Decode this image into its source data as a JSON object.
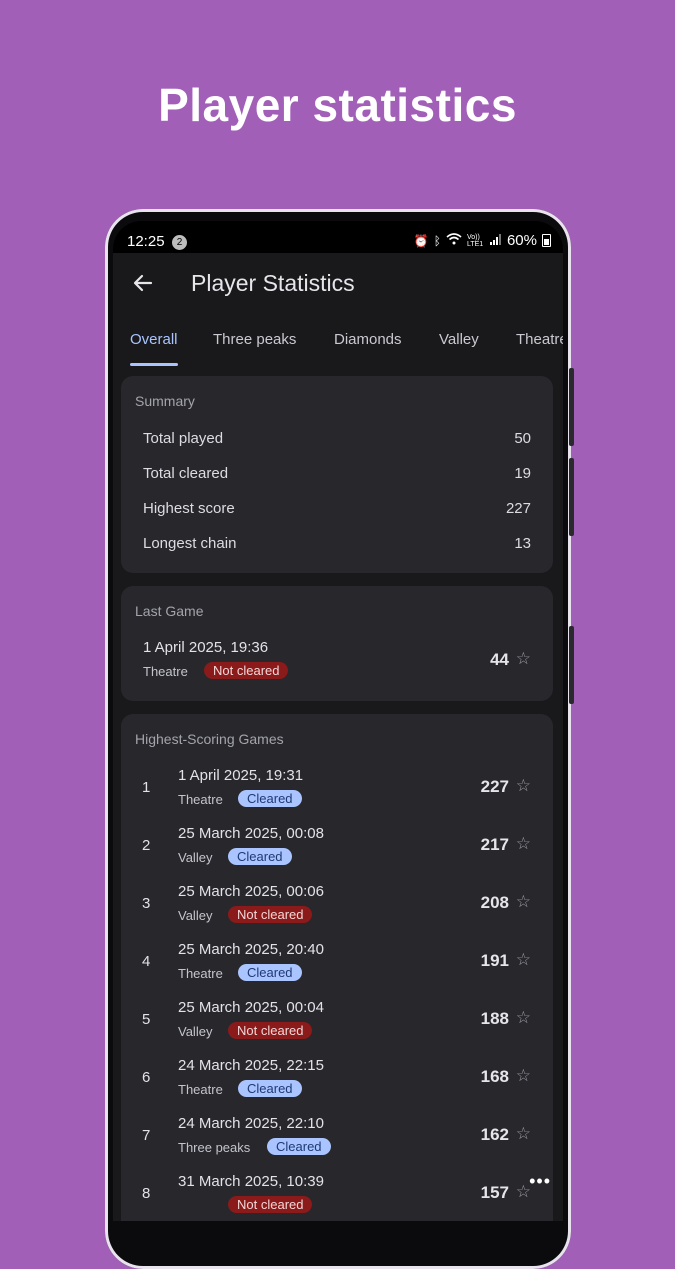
{
  "promo": {
    "title": "Player statistics"
  },
  "status_bar": {
    "time": "12:25",
    "notification_count": "2",
    "network": "Vo)) LTE1",
    "battery": "60%"
  },
  "app_bar": {
    "title": "Player Statistics"
  },
  "tabs": [
    {
      "label": "Overall",
      "active": true
    },
    {
      "label": "Three peaks",
      "active": false
    },
    {
      "label": "Diamonds",
      "active": false
    },
    {
      "label": "Valley",
      "active": false
    },
    {
      "label": "Theatre",
      "active": false
    }
  ],
  "summary": {
    "title": "Summary",
    "rows": [
      {
        "label": "Total played",
        "value": "50"
      },
      {
        "label": "Total cleared",
        "value": "19"
      },
      {
        "label": "Highest score",
        "value": "227"
      },
      {
        "label": "Longest chain",
        "value": "13"
      }
    ]
  },
  "last_game": {
    "title": "Last Game",
    "date": "1 April 2025, 19:36",
    "mode": "Theatre",
    "status": "Not cleared",
    "score": "44"
  },
  "highest": {
    "title": "Highest-Scoring Games",
    "games": [
      {
        "rank": "1",
        "date": "1 April 2025, 19:31",
        "mode": "Theatre",
        "status": "Cleared",
        "score": "227"
      },
      {
        "rank": "2",
        "date": "25 March 2025, 00:08",
        "mode": "Valley",
        "status": "Cleared",
        "score": "217"
      },
      {
        "rank": "3",
        "date": "25 March 2025, 00:06",
        "mode": "Valley",
        "status": "Not cleared",
        "score": "208"
      },
      {
        "rank": "4",
        "date": "25 March 2025, 20:40",
        "mode": "Theatre",
        "status": "Cleared",
        "score": "191"
      },
      {
        "rank": "5",
        "date": "25 March 2025, 00:04",
        "mode": "Valley",
        "status": "Not cleared",
        "score": "188"
      },
      {
        "rank": "6",
        "date": "24 March 2025, 22:15",
        "mode": "Theatre",
        "status": "Cleared",
        "score": "168"
      },
      {
        "rank": "7",
        "date": "24 March 2025, 22:10",
        "mode": "Three peaks",
        "status": "Cleared",
        "score": "162"
      },
      {
        "rank": "8",
        "date": "31 March 2025, 10:39",
        "mode": "",
        "status": "Not cleared",
        "score": "157"
      }
    ]
  },
  "colors": {
    "background": "#a25fb8",
    "accent": "#a9c4ff",
    "not_cleared": "#8b1a1a"
  },
  "icons": {
    "back": "arrow-left-icon",
    "star": "star-outline-icon",
    "more": "more-horizontal-icon"
  }
}
